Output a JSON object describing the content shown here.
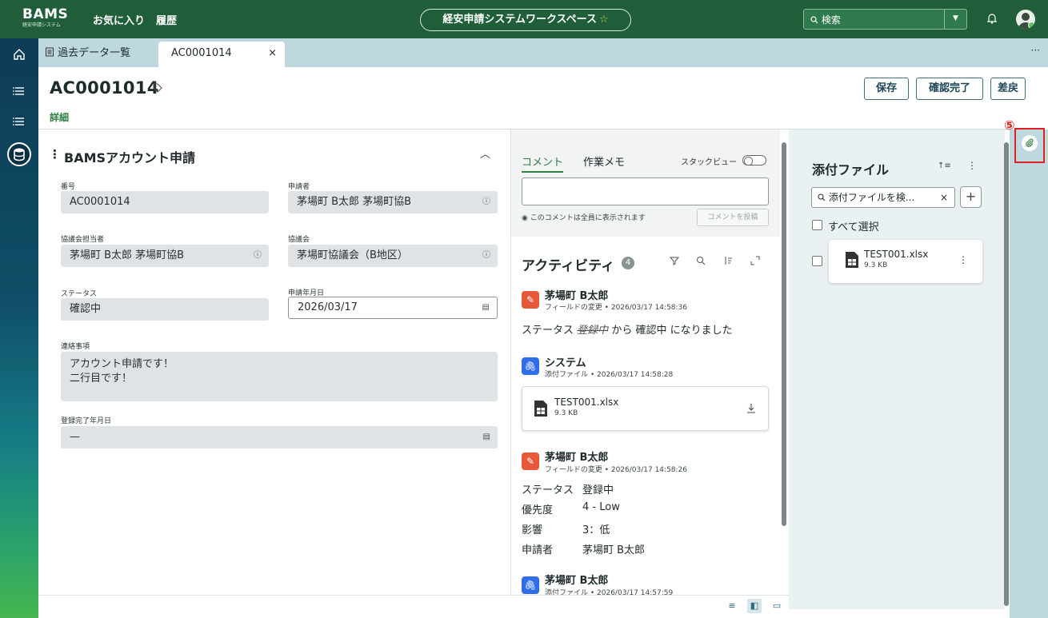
{
  "topbar": {
    "logo": "BAMS",
    "logo_sub": "経安申請システム",
    "favorites": "お気に入り",
    "history": "履歴",
    "workspace": "経安申請システムワークスペース",
    "workspace_star": "☆",
    "search_placeholder": "検索"
  },
  "tabs": {
    "list_tab": "過去データ一覧",
    "record_tab": "AC0001014",
    "close": "×",
    "more": "···"
  },
  "header": {
    "title": "AC0001014",
    "save": "保存",
    "confirm": "確認完了",
    "reject": "差戻",
    "detail_tab": "詳細"
  },
  "form": {
    "section_title": "BAMSアカウント申請",
    "fields": {
      "number_label": "番号",
      "number_value": "AC0001014",
      "applicant_label": "申請者",
      "applicant_value": "茅場町 B太郎 茅場町協B",
      "council_staff_label": "協議会担当者",
      "council_staff_value": "茅場町 B太郎 茅場町協B",
      "council_label": "協議会",
      "council_value": "茅場町協議会（B地区）",
      "status_label": "ステータス",
      "status_value": "確認中",
      "date_label": "申請年月日",
      "date_value": "2026/03/17",
      "notes_label": "連絡事項",
      "notes_line1": "アカウント申請です！",
      "notes_line2": "二行目です！",
      "done_label": "登録完了年月日",
      "done_value": "—"
    }
  },
  "comments": {
    "tab_comment": "コメント",
    "tab_memo": "作業メモ",
    "stack_view": "スタックビュー",
    "visibility_note": "このコメントは全員に表示されます",
    "post_button": "コメントを投稿"
  },
  "activity": {
    "title": "アクティビティ",
    "count": "4",
    "entries": [
      {
        "name": "茅場町 B太郎",
        "meta": "フィールドの変更 • 2026/03/17 14:58:36",
        "text_prefix": "ステータス",
        "text_old": "登録中",
        "text_mid": "から 確認中 になりました"
      },
      {
        "name": "システム",
        "meta": "添付ファイル • 2026/03/17 14:58:28",
        "file_name": "TEST001.xlsx",
        "file_size": "9.3 KB"
      },
      {
        "name": "茅場町 B太郎",
        "meta": "フィールドの変更 • 2026/03/17 14:58:26",
        "rows": [
          {
            "k": "ステータス",
            "v": "登録中"
          },
          {
            "k": "優先度",
            "v": "4 - Low"
          },
          {
            "k": "影響",
            "v": "3：低"
          },
          {
            "k": "申請者",
            "v": "茅場町 B太郎"
          }
        ]
      },
      {
        "name": "茅場町 B太郎",
        "meta": "添付ファイル • 2026/03/17 14:57:59"
      }
    ]
  },
  "attachments": {
    "title": "添付ファイル",
    "search_placeholder": "添付ファイルを検...",
    "select_all": "すべて選択",
    "file_name": "TEST001.xlsx",
    "file_size": "9.3 KB"
  },
  "annotation": {
    "marker": "⑤",
    "color": "#e02020"
  }
}
